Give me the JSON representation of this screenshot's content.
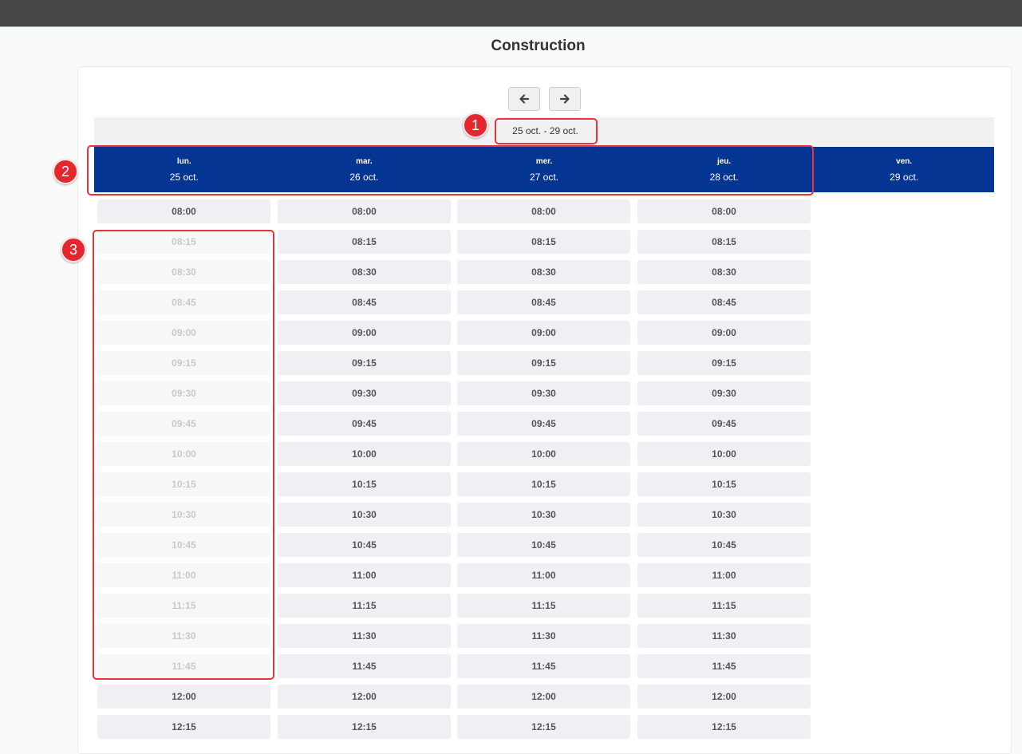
{
  "title": "Construction",
  "nav": {
    "prev_icon": "arrow-left-icon",
    "next_icon": "arrow-right-icon"
  },
  "range_label": "25 oct. - 29 oct.",
  "days": [
    {
      "name": "lun.",
      "date": "25 oct."
    },
    {
      "name": "mar.",
      "date": "26 oct."
    },
    {
      "name": "mer.",
      "date": "27 oct."
    },
    {
      "name": "jeu.",
      "date": "28 oct."
    },
    {
      "name": "ven.",
      "date": "29 oct."
    }
  ],
  "times": [
    "08:00",
    "08:15",
    "08:30",
    "08:45",
    "09:00",
    "09:15",
    "09:30",
    "09:45",
    "10:00",
    "10:15",
    "10:30",
    "10:45",
    "11:00",
    "11:15",
    "11:30",
    "11:45",
    "12:00",
    "12:15"
  ],
  "slot_columns": 4,
  "disabled_slots": {
    "0": [
      "08:15",
      "08:30",
      "08:45",
      "09:00",
      "09:15",
      "09:30",
      "09:45",
      "10:00",
      "10:15",
      "10:30",
      "10:45",
      "11:00",
      "11:15",
      "11:30",
      "11:45"
    ]
  },
  "annotations": [
    "1",
    "2",
    "3"
  ],
  "colors": {
    "header_bg": "#043592",
    "annotation": "#e4262d",
    "topbar": "#474747"
  }
}
